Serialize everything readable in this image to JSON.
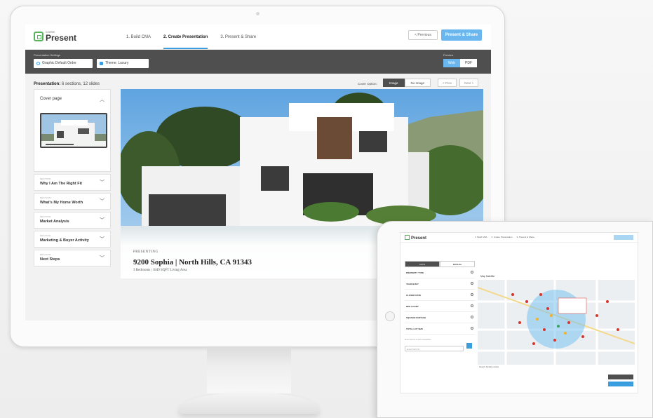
{
  "app": {
    "logo_small": "CORE",
    "logo_name": "Present",
    "steps": [
      "1. Build CMA",
      "2. Create Presentation",
      "3. Present & Share"
    ],
    "previous_label": "< Previous",
    "present_share_label": "Present & Share"
  },
  "settings": {
    "label": "Presentation Settings",
    "graphic_order": "Graphic Default Order",
    "theme": "Theme: Luxury",
    "preview_label": "Preview",
    "preview_options": [
      "Web",
      "PDF"
    ],
    "preview_selected": "Web"
  },
  "presentation": {
    "label": "Presentation:",
    "summary": "6 sections, 12 slides",
    "cover_option_label": "Cover Option:",
    "cover_options": [
      "Image",
      "No Image"
    ],
    "cover_selected": "Image",
    "prev_label": "< Prev",
    "next_label": "Next >"
  },
  "sidebar": {
    "cover_title": "Cover page",
    "sections": [
      {
        "tag": "SECTION",
        "name": "Why I Am The Right Fit"
      },
      {
        "tag": "SECTION",
        "name": "What's My Home Worth"
      },
      {
        "tag": "SECTION",
        "name": "Market Analysis"
      },
      {
        "tag": "SECTION",
        "name": "Marketing & Buyer Activity"
      },
      {
        "tag": "SECTION",
        "name": "Next Steps"
      }
    ]
  },
  "slide": {
    "presenting": "PRESENTING",
    "address": "9200 Sophia | North Hills, CA 91343",
    "details": "3 Bedrooms | 1849 SQFT Living Area"
  },
  "tablet": {
    "logo": "Present",
    "steps": [
      "1. Build CMA",
      "2. Create Presentation",
      "3. Present & Share"
    ],
    "tabs": [
      "AUTO",
      "MANUAL"
    ],
    "filters": [
      "PROPERTY TYPE",
      "YEAR BUILT",
      "CLOSED DATE",
      "BED COUNT",
      "SQUARE FOOTAGE",
      "TOTAL LOT SIZE"
    ],
    "search_hint": "Enter MLS ID to add comparables",
    "search_placeholder": "Enter MLS ID",
    "map_tabs": "Map   Satellite",
    "legend": "Closed • Pending • Active"
  },
  "colors": {
    "accent": "#3a9ddf",
    "brand_green": "#57b45c",
    "settings_bar": "#4f4f4f"
  }
}
